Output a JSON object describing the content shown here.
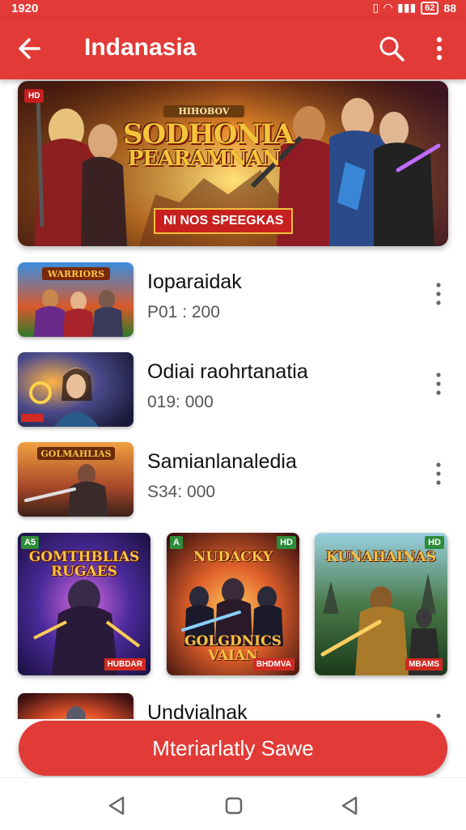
{
  "status": {
    "time": "1920",
    "right_text": "88",
    "battery": "62"
  },
  "appbar": {
    "title": "Indanasia"
  },
  "banner": {
    "badge": "HD",
    "title_small": "HIHOBOV",
    "title_line1": "SODHONIA",
    "title_line2": "PEARAMNAN",
    "subtitle": "NI NOS SPEEGKAS"
  },
  "list": [
    {
      "name": "Ioparaidak",
      "meta": "P01 : 200"
    },
    {
      "name": "Odiai raohrtanatia",
      "meta": "019: 000"
    },
    {
      "name": "Samianlanaledia",
      "meta": "S34: 000"
    },
    {
      "name": "Undvialnak",
      "meta": ""
    }
  ],
  "cards": [
    {
      "tag_left": "A5",
      "tag_right": "",
      "title": "GOMTHBLIAS RUGAES",
      "badge": "HUBDAR",
      "extra": ""
    },
    {
      "tag_left": "A",
      "tag_right": "HD",
      "title": "NUDACKY",
      "badge": "BHDMVA",
      "extra": "GOLGDNICS VAIAN"
    },
    {
      "tag_left": "",
      "tag_right": "HD",
      "title": "KUNAHAINAS",
      "badge": "MBAMS",
      "extra": ""
    }
  ],
  "thumb_labels": [
    "WARRIORS",
    "GOLMAHLIAS"
  ],
  "cta": {
    "label": "Mteriarlatly Sawe"
  },
  "colors": {
    "primary": "#e23a36",
    "text": "#111111",
    "muted": "#555555"
  },
  "icons": [
    "back-arrow-icon",
    "search-icon",
    "more-vert-icon",
    "nav-back-icon",
    "nav-home-icon",
    "nav-recents-icon"
  ]
}
